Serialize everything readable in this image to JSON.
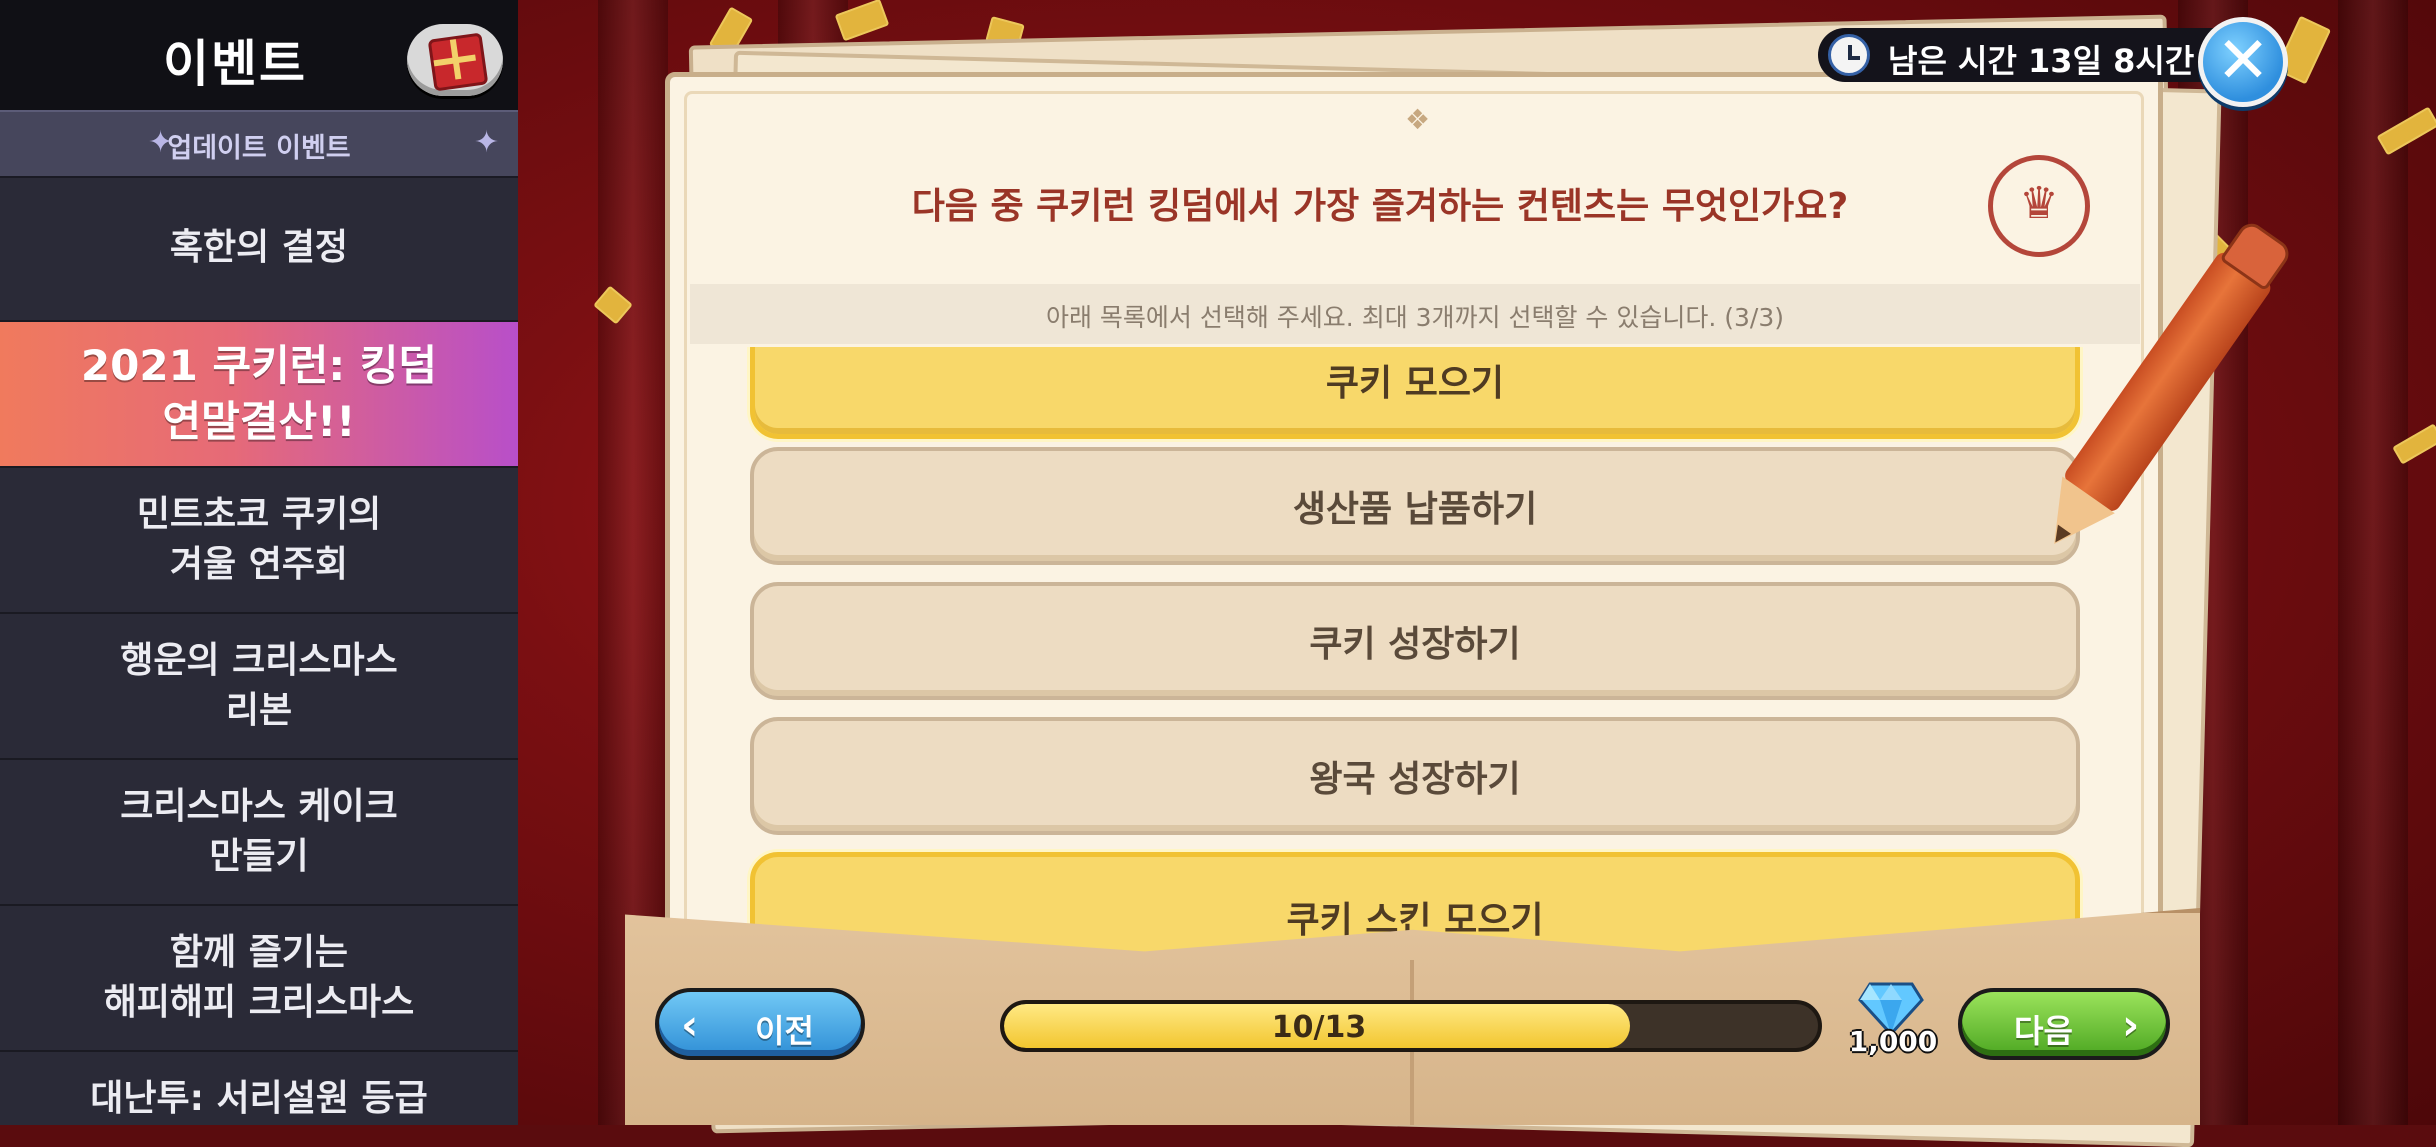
{
  "sidebar": {
    "title": "이벤트",
    "subheader": "업데이트 이벤트",
    "items": [
      {
        "label": "혹한의 결정"
      },
      {
        "label": "2021 쿠키런: 킹덤\n연말결산!!"
      },
      {
        "label": "민트초코 쿠키의\n겨울 연주회"
      },
      {
        "label": "행운의 크리스마스\n리본"
      },
      {
        "label": "크리스마스 케이크\n만들기"
      },
      {
        "label": "함께 즐기는\n해피해피 크리스마스"
      },
      {
        "label": "대난투: 서리설원 등급"
      }
    ]
  },
  "timer": {
    "text": "남은 시간 13일 8시간"
  },
  "survey": {
    "question": "다음 중 쿠키런 킹덤에서 가장 즐겨하는 컨텐츠는 무엇인가요?",
    "instruction": "아래 목록에서 선택해 주세요. 최대 3개까지 선택할 수 있습니다. (3/3)",
    "options": [
      {
        "label": "쿠키 모으기",
        "selected": true
      },
      {
        "label": "생산품 납품하기",
        "selected": false
      },
      {
        "label": "쿠키 성장하기",
        "selected": false
      },
      {
        "label": "왕국 성장하기",
        "selected": false
      },
      {
        "label": "쿠키 스킨 모으기",
        "selected": true
      }
    ]
  },
  "nav": {
    "prev_label": "이전",
    "next_label": "다음",
    "progress_text": "10/13",
    "progress_fraction": 0.769,
    "gem_count": "1,000"
  },
  "colors": {
    "accent_red": "#9a3527",
    "selected_yellow": "#f8d86a",
    "prev_blue": "#2f8fd6",
    "next_green": "#4da722"
  },
  "icons": {
    "gift": "gift-icon",
    "clock": "clock-icon",
    "close": "close-icon",
    "emblem": "crown-emblem-icon",
    "gem": "crystal-gem-icon"
  }
}
